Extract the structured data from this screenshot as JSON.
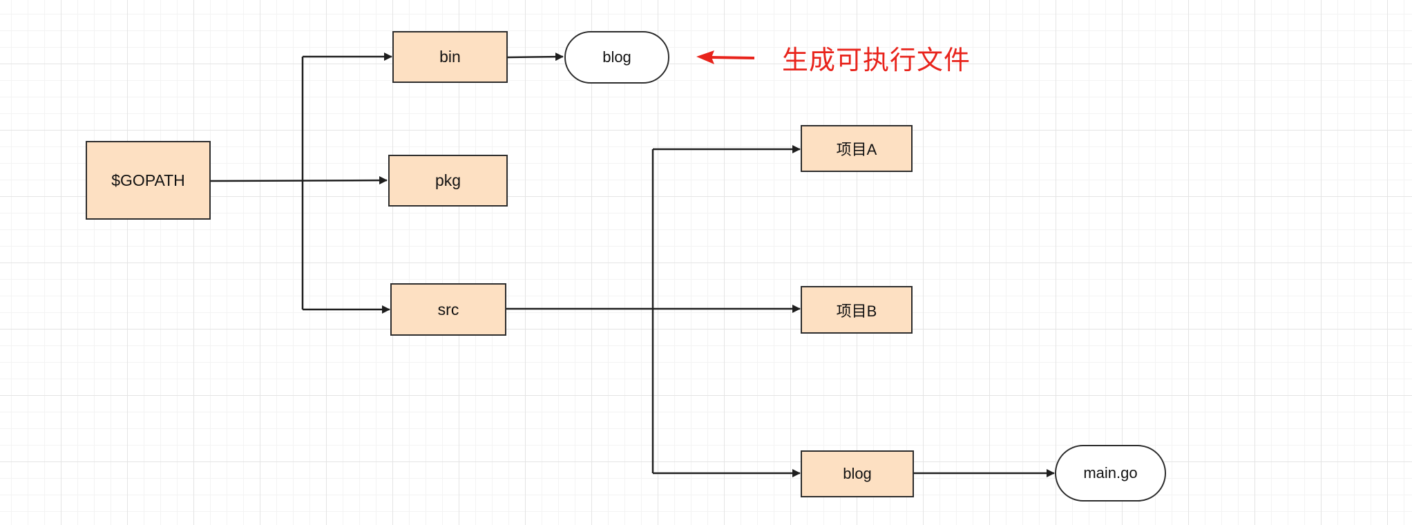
{
  "nodes": {
    "gopath": "$GOPATH",
    "bin": "bin",
    "pkg": "pkg",
    "src": "src",
    "bin_blog": "blog",
    "project_a": "项目A",
    "project_b": "项目B",
    "src_blog": "blog",
    "main_go": "main.go"
  },
  "annotation": {
    "text": "生成可执行文件",
    "color": "#e8231b"
  },
  "colors": {
    "box_fill": "#fde0c2",
    "stroke": "#2b2b2b",
    "terminal_fill": "#ffffff"
  }
}
